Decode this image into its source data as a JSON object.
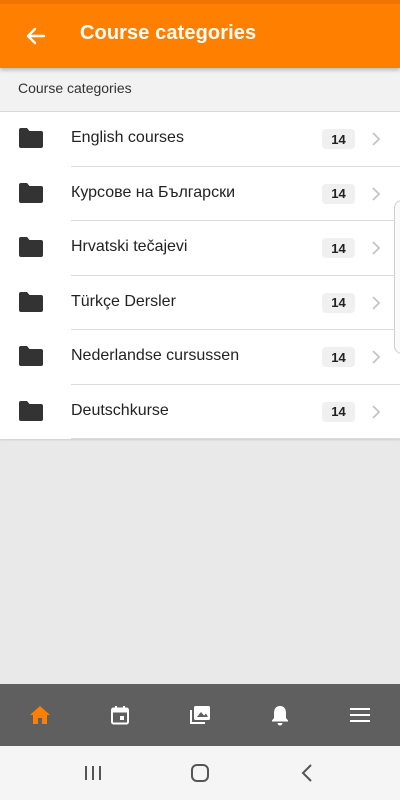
{
  "header": {
    "title": "Course categories",
    "back_icon": "arrow-left-icon",
    "color": "#ff8000"
  },
  "section": {
    "title": "Course categories"
  },
  "categories": [
    {
      "label": "English courses",
      "count": "14"
    },
    {
      "label": "Курсове на Български",
      "count": "14"
    },
    {
      "label": "Hrvatski tečajevi",
      "count": "14"
    },
    {
      "label": "Türkçe Dersler",
      "count": "14"
    },
    {
      "label": "Nederlandse cursussen",
      "count": "14"
    },
    {
      "label": "Deutschkurse",
      "count": "14"
    }
  ],
  "tabbar": {
    "tabs": [
      {
        "name": "home",
        "icon": "home-icon",
        "active": true
      },
      {
        "name": "calendar",
        "icon": "calendar-icon",
        "active": false
      },
      {
        "name": "courses",
        "icon": "courses-icon",
        "active": false
      },
      {
        "name": "notifications",
        "icon": "bell-icon",
        "active": false
      },
      {
        "name": "more",
        "icon": "menu-icon",
        "active": false
      }
    ],
    "active_color": "#ff8000",
    "inactive_color": "#ffffff",
    "background": "#5f5f5f"
  },
  "system_nav": {
    "buttons": [
      "recent-apps-icon",
      "home-circle-icon",
      "back-chevron-icon"
    ]
  }
}
